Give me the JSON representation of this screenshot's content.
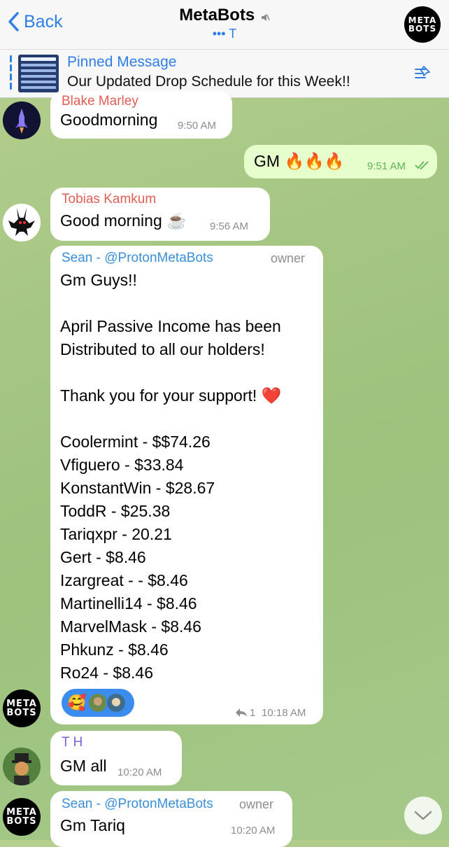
{
  "header": {
    "back_label": "Back",
    "title": "MetaBots",
    "subtitle": "••• T",
    "avatar_text": [
      "META",
      "BOTS"
    ]
  },
  "pinned": {
    "title": "Pinned Message",
    "text": "Our Updated Drop Schedule for this Week!!"
  },
  "messages": [
    {
      "sender": "Blake Marley",
      "text": "Goodmorning",
      "time": "9:50 AM"
    },
    {
      "text": "GM 🔥🔥🔥",
      "time": "9:51 AM",
      "outgoing": true,
      "status": "read"
    },
    {
      "sender": "Tobias Kamkum",
      "text": "Good morning ☕️",
      "time": "9:56 AM"
    },
    {
      "sender": "Sean - @ProtonMetaBots",
      "role": "owner",
      "lines": [
        "Gm Guys!!",
        "",
        "April Passive Income has been",
        "Distributed to all our holders!",
        "",
        "Thank you for your support! ❤️",
        "",
        "Coolermint - $$74.26",
        "Vfiguero - $33.84",
        "KonstantWin - $28.67",
        "ToddR  -  $25.38",
        "Tariqxpr - 20.21",
        "Gert - $8.46",
        "Izargreat -  - $8.46",
        "Martinelli14 - $8.46",
        "MarvelMask  - $8.46",
        "Phkunz - $8.46",
        "Ro24 - $8.46"
      ],
      "reaction_emoji": "🥰",
      "reply_count": "1",
      "time": "10:18 AM"
    },
    {
      "sender": "T H",
      "text": "GM all",
      "time": "10:20 AM"
    },
    {
      "sender": "Sean - @ProtonMetaBots",
      "role": "owner",
      "text": "Gm Tariq",
      "time": "10:20 AM"
    }
  ],
  "avatars": {
    "metabots": [
      "META",
      "BOTS"
    ]
  },
  "colors": {
    "accent": "#2f7ee6",
    "outgoing_bubble": "#e6fecb",
    "sender_red": "#e05e53",
    "sender_blue": "#3a8fd8",
    "reaction_bg": "#3a8cee"
  }
}
